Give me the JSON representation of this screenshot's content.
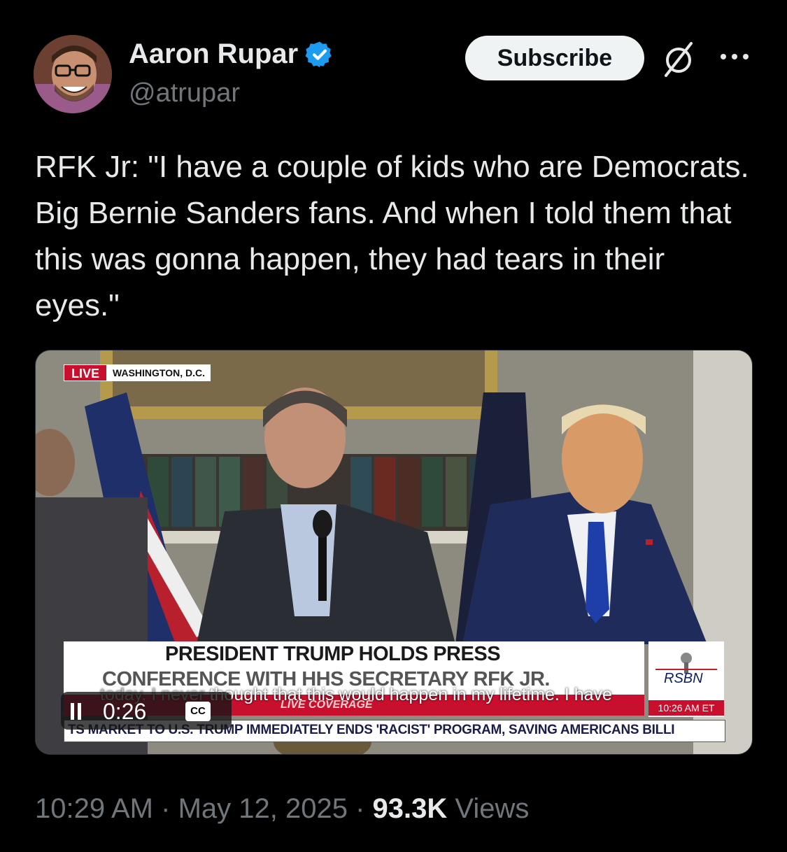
{
  "author": {
    "name": "Aaron Rupar",
    "handle": "@atrupar",
    "verified": true,
    "avatar_icon": "avatar-photo"
  },
  "actions": {
    "subscribe_label": "Subscribe",
    "grok_icon": "slashed-circle-icon",
    "more_icon": "more-horizontal-icon"
  },
  "tweet": {
    "text": "RFK Jr: \"I have a couple of kids who are Democrats. Big Bernie Sanders fans. And when I told them that this was gonna happen, they had tears in their eyes.\""
  },
  "video": {
    "live_label": "LIVE",
    "location_label": "WASHINGTON, D.C.",
    "chyron_line1": "PRESIDENT TRUMP HOLDS PRESS",
    "chyron_line2": "CONFERENCE WITH HHS SECRETARY RFK JR.",
    "live_coverage_label": "LIVE COVERAGE",
    "ticker_text": "TS MARKET TO U.S.    TRUMP IMMEDIATELY ENDS 'RACIST' PROGRAM, SAVING AMERICANS BILLI",
    "network_label": "RSBN",
    "network_time": "10:26 AM ET",
    "caption_dim": "today. I never ",
    "caption_text": "thought that this would happen in my lifetime. I have",
    "playback_time": "0:26",
    "cc_label": "CC",
    "state": "playing"
  },
  "meta": {
    "time": "10:29 AM",
    "separator": " · ",
    "date": "May 12, 2025",
    "views_count": "93.3K",
    "views_label": "Views"
  },
  "colors": {
    "background": "#000000",
    "text_primary": "#e7e9ea",
    "text_secondary": "#71767b",
    "verified_blue": "#1d9bf0",
    "subscribe_bg": "#eff3f4",
    "chyron_red": "#c8102e"
  }
}
